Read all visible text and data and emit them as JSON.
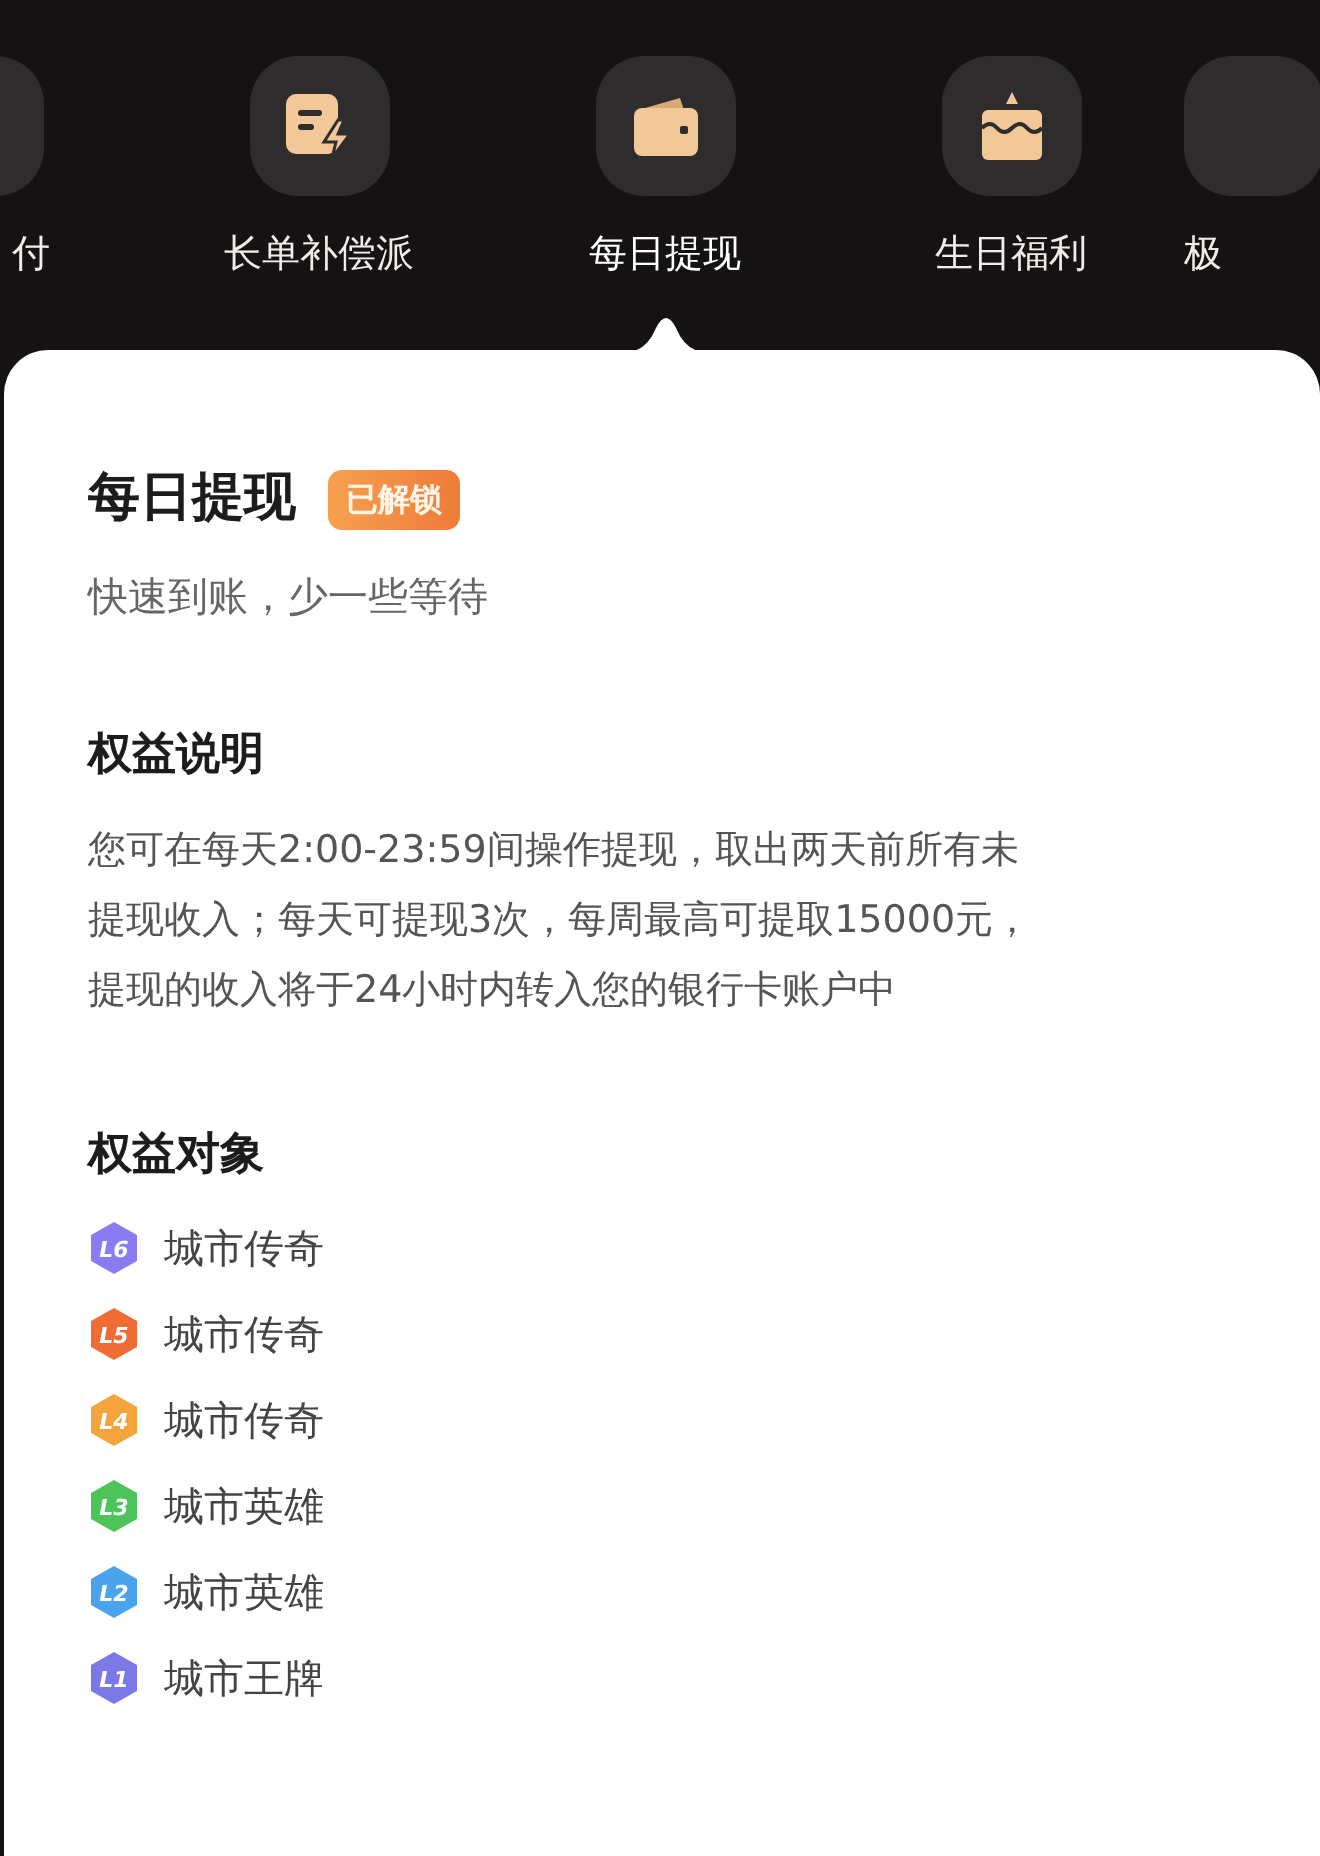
{
  "tabs": [
    {
      "label": "付",
      "kind": "edge",
      "selected": false
    },
    {
      "label": "长单补偿派",
      "kind": "document",
      "selected": false
    },
    {
      "label": "每日提现",
      "kind": "wallet",
      "selected": true
    },
    {
      "label": "生日福利",
      "kind": "cake",
      "selected": false
    },
    {
      "label": "极",
      "kind": "edge",
      "selected": false
    }
  ],
  "detail": {
    "title": "每日提现",
    "badge": "已解锁",
    "subtitle": "快速到账，少一些等待",
    "sections": [
      {
        "heading": "权益说明",
        "lines": [
          "您可在每天2:00-23:59间操作提现，取出两天前所有未",
          "提现收入；每天可提现3次，每周最高可提取15000元，",
          "提现的收入将于24小时内转入您的银行卡账户中"
        ]
      },
      {
        "heading": "权益对象",
        "levels": [
          {
            "level": "L6",
            "name": "城市传奇",
            "color": "#8a7cf2"
          },
          {
            "level": "L5",
            "name": "城市传奇",
            "color": "#ef6d35"
          },
          {
            "level": "L4",
            "name": "城市传奇",
            "color": "#f4a43a"
          },
          {
            "level": "L3",
            "name": "城市英雄",
            "color": "#4cc45a"
          },
          {
            "level": "L2",
            "name": "城市英雄",
            "color": "#4aa3ec"
          },
          {
            "level": "L1",
            "name": "城市王牌",
            "color": "#7c78e6"
          }
        ]
      }
    ]
  }
}
